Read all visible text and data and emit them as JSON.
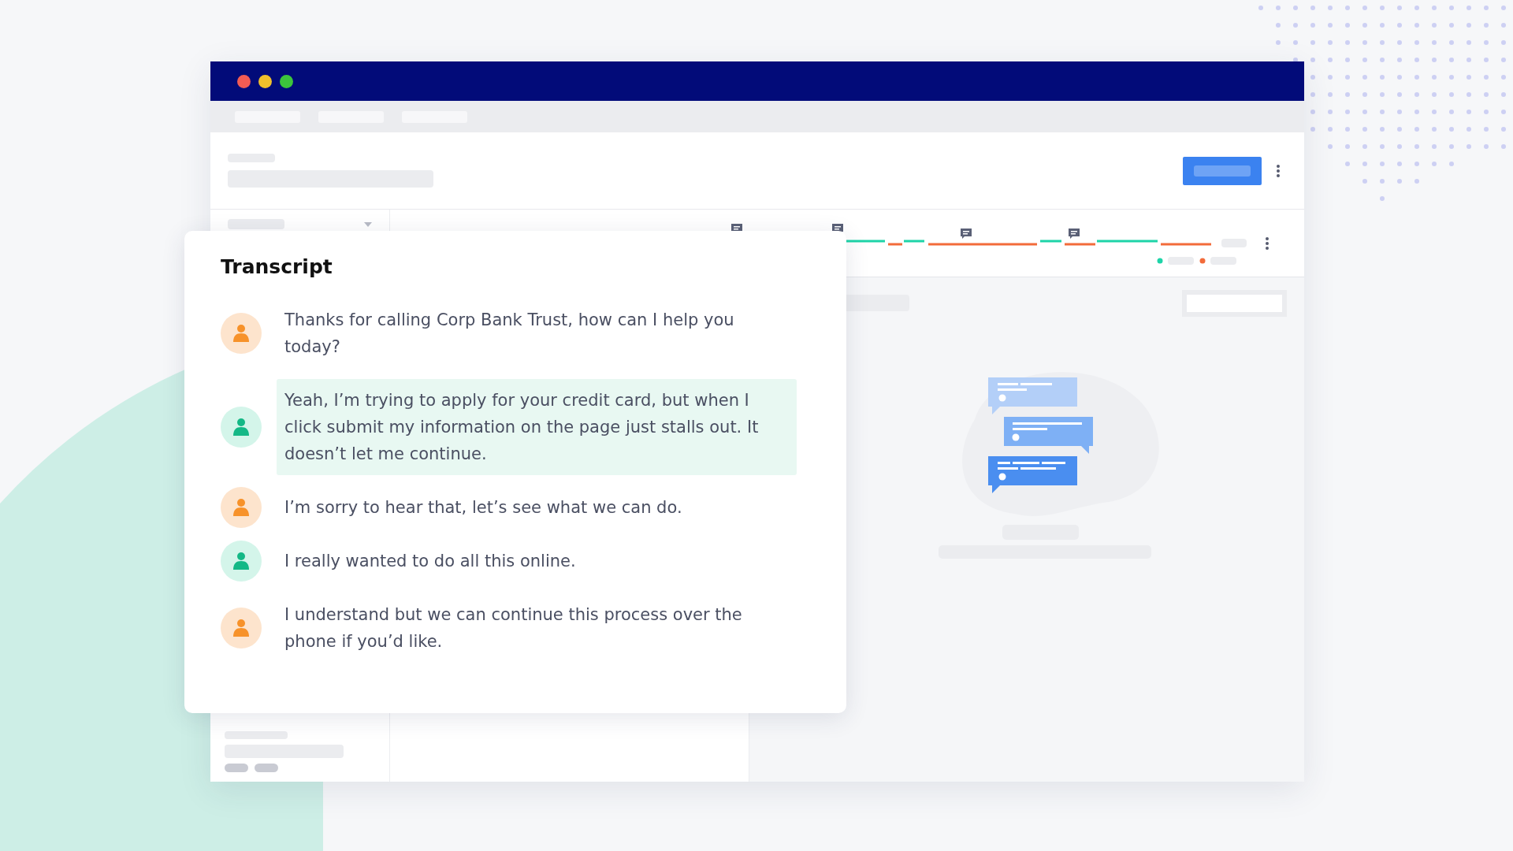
{
  "transcript": {
    "title": "Transcript",
    "messages": [
      {
        "kind": "agent",
        "highlighted": false,
        "text": "Thanks for calling Corp Bank Trust, how can I help you today?"
      },
      {
        "kind": "customer",
        "highlighted": true,
        "text": "Yeah, I’m trying to apply for your credit card, but when I click submit my information on the page just stalls out. It doesn’t let me continue."
      },
      {
        "kind": "agent",
        "highlighted": false,
        "text": "I’m sorry to hear that, let’s see what we can do."
      },
      {
        "kind": "customer",
        "highlighted": false,
        "text": "I really wanted to do all this online."
      },
      {
        "kind": "agent",
        "highlighted": false,
        "text": "I understand but we can continue this process over the phone if you’d like."
      }
    ]
  }
}
